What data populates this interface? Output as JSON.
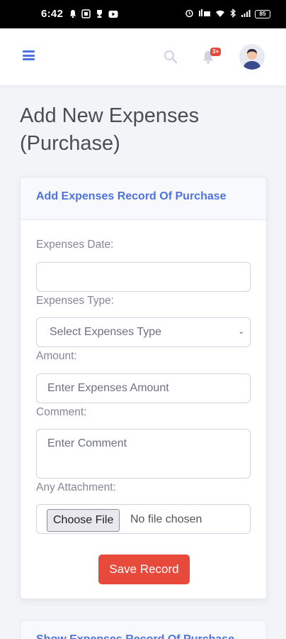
{
  "status_bar": {
    "time": "6:42",
    "battery": "85",
    "left_icons": [
      "notification-bell-icon",
      "app-icon",
      "trophy-icon",
      "youtube-icon"
    ],
    "right_icons": [
      "alarm-icon",
      "volte-icon",
      "wifi-icon",
      "bluetooth-icon",
      "signal-icon"
    ]
  },
  "topbar": {
    "notification_badge": "3+",
    "accent_color": "#4e73df"
  },
  "page": {
    "title": "Add New Expenses (Purchase)"
  },
  "form_card": {
    "title": "Add Expenses Record Of Purchase",
    "fields": {
      "date_label": "Expenses Date:",
      "date_value": "",
      "type_label": "Expenses Type:",
      "type_selected": "Select Expenses Type",
      "amount_label": "Amount:",
      "amount_placeholder": "Enter Expenses Amount",
      "comment_label": "Comment:",
      "comment_placeholder": "Enter Comment",
      "attachment_label": "Any Attachment:",
      "file_button": "Choose File",
      "file_status": "No file chosen"
    },
    "save_button": "Save Record",
    "save_color": "#e74a3b"
  },
  "list_card": {
    "title": "Show Expenses Record Of Purchase"
  }
}
